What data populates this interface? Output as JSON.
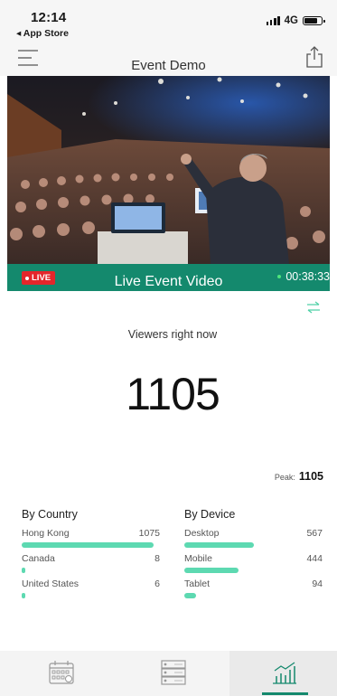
{
  "status_bar": {
    "time": "12:14",
    "back_app": "◂ App Store",
    "network": "4G"
  },
  "nav": {
    "title": "Event Demo",
    "menu_icon": "hamburger-menu-icon",
    "share_icon": "share-icon"
  },
  "video": {
    "live_badge": "LIVE",
    "title": "Live Event Video",
    "elapsed": "00:38:33"
  },
  "stats": {
    "viewers_label": "Viewers right now",
    "viewers_count": "1105",
    "peak_label": "Peak:",
    "peak_value": "1105",
    "by_country": {
      "title": "By Country",
      "items": [
        {
          "name": "Hong Kong",
          "count": "1075",
          "fraction": 0.973
        },
        {
          "name": "Canada",
          "count": "8",
          "fraction": 0.007
        },
        {
          "name": "United States",
          "count": "6",
          "fraction": 0.005
        }
      ]
    },
    "by_device": {
      "title": "By Device",
      "items": [
        {
          "name": "Desktop",
          "count": "567",
          "fraction": 0.513
        },
        {
          "name": "Mobile",
          "count": "444",
          "fraction": 0.402
        },
        {
          "name": "Tablet",
          "count": "94",
          "fraction": 0.085
        }
      ]
    }
  },
  "tabbar": {
    "items": [
      {
        "icon": "calendar-icon",
        "active": false
      },
      {
        "icon": "server-list-icon",
        "active": false
      },
      {
        "icon": "bar-chart-icon",
        "active": true
      }
    ]
  },
  "colors": {
    "accent_green": "#14896d",
    "bar_green": "#5dd9b1",
    "live_red": "#e4262b"
  }
}
